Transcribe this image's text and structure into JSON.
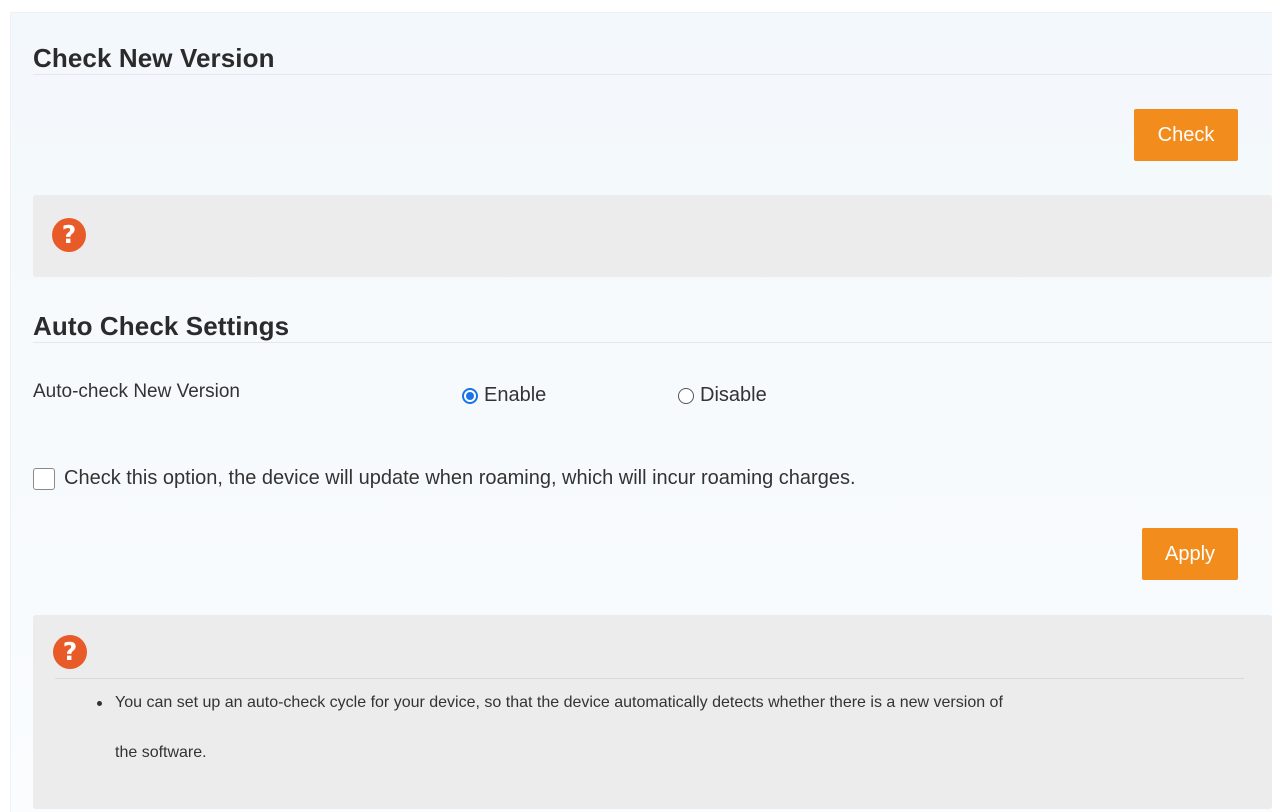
{
  "check_section": {
    "title": "Check New Version",
    "check_button": "Check",
    "help_icon_glyph": "?"
  },
  "auto_section": {
    "title": "Auto Check Settings",
    "field_label": "Auto-check New Version",
    "radio_enable": "Enable",
    "radio_disable": "Disable",
    "selected": "Enable",
    "roaming_checkbox_label": "Check this option, the device will update when roaming, which will incur roaming charges.",
    "roaming_checked": false,
    "apply_button": "Apply",
    "help_icon_glyph": "?",
    "help_text_line1": "You can set up an auto-check cycle for your device, so that the device automatically detects whether there is a new version of",
    "help_text_line2": "the software."
  },
  "colors": {
    "accent_orange": "#f28c1c",
    "help_icon": "#e85a27",
    "radio_selected": "#1a73e8",
    "help_box_bg": "#ececec"
  },
  "icons": {
    "help": "question-mark-circle-icon"
  }
}
